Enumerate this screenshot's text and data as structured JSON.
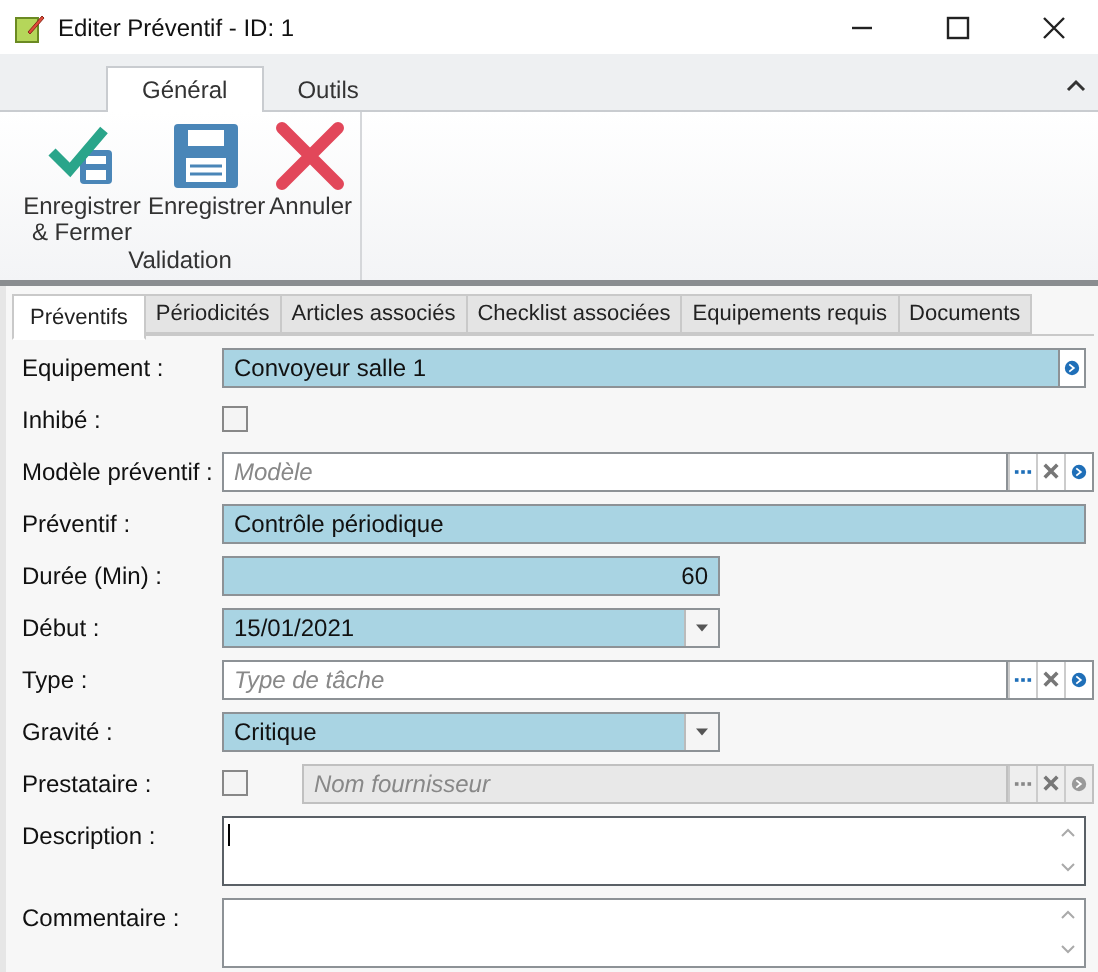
{
  "window": {
    "title": "Editer Préventif - ID: 1"
  },
  "ribbon": {
    "tabs": [
      {
        "label": "Général",
        "selected": true
      },
      {
        "label": "Outils",
        "selected": false
      }
    ],
    "groups": [
      {
        "label": "Validation",
        "buttons": [
          {
            "label": "Enregistrer & Fermer",
            "kind": "save-close"
          },
          {
            "label": "Enregistrer",
            "kind": "save"
          },
          {
            "label": "Annuler",
            "kind": "cancel"
          }
        ]
      }
    ]
  },
  "form_tabs": [
    {
      "label": "Préventifs",
      "selected": true
    },
    {
      "label": "Périodicités",
      "selected": false
    },
    {
      "label": "Articles associés",
      "selected": false
    },
    {
      "label": "Checklist associées",
      "selected": false
    },
    {
      "label": "Equipements requis",
      "selected": false
    },
    {
      "label": "Documents",
      "selected": false
    }
  ],
  "fields": [
    {
      "kind": "lookup-filled",
      "label": "Equipement :",
      "value": "Convoyeur salle 1"
    },
    {
      "kind": "checkbox",
      "label": "Inhibé :",
      "checked": false
    },
    {
      "kind": "lookup",
      "label": "Modèle préventif :",
      "placeholder": "Modèle",
      "disabled": false
    },
    {
      "kind": "text",
      "label": "Préventif :",
      "value": "Contrôle périodique"
    },
    {
      "kind": "number",
      "label": "Durée (Min) :",
      "value": "60"
    },
    {
      "kind": "combo",
      "label": "Début :",
      "value": "15/01/2021"
    },
    {
      "kind": "lookup",
      "label": "Type :",
      "placeholder": "Type de tâche",
      "disabled": false
    },
    {
      "kind": "combo",
      "label": "Gravité :",
      "value": "Critique"
    },
    {
      "kind": "check-lookup",
      "label": "Prestataire :",
      "checked": false,
      "placeholder": "Nom fournisseur",
      "disabled": true
    },
    {
      "kind": "memo",
      "label": "Description :",
      "focused": true
    },
    {
      "kind": "memo",
      "label": "Commentaire :",
      "focused": false
    }
  ]
}
